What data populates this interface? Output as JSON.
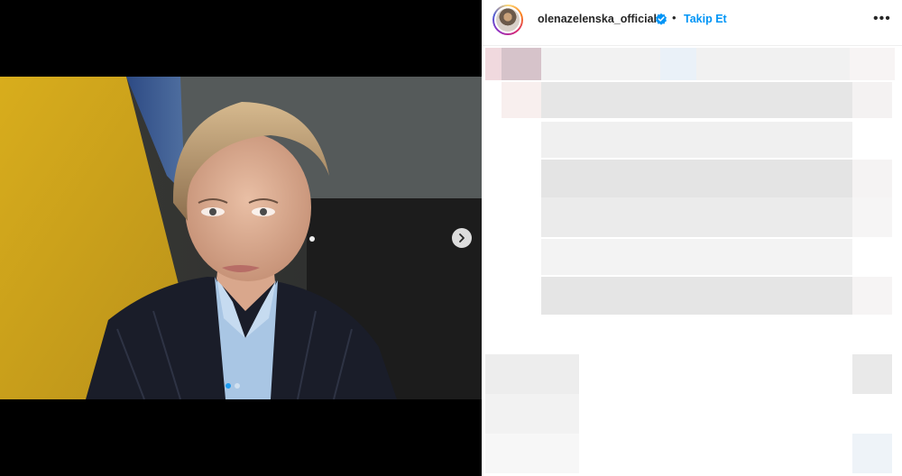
{
  "post": {
    "author": {
      "username": "olenazelenska_official",
      "verified": true,
      "avatar_icon": "profile-avatar"
    },
    "separator": "•",
    "follow_label": "Takip Et",
    "more_icon": "more-horizontal-icon",
    "more_glyph": "•••",
    "carousel": {
      "current_slide": 1,
      "total_slides": 2,
      "next_icon": "chevron-right-icon"
    },
    "caption_state": "pixelated",
    "colors": {
      "follow_link": "#0095f6",
      "verified_badge": "#0095f6",
      "active_dot": "#1d9bf0"
    }
  }
}
